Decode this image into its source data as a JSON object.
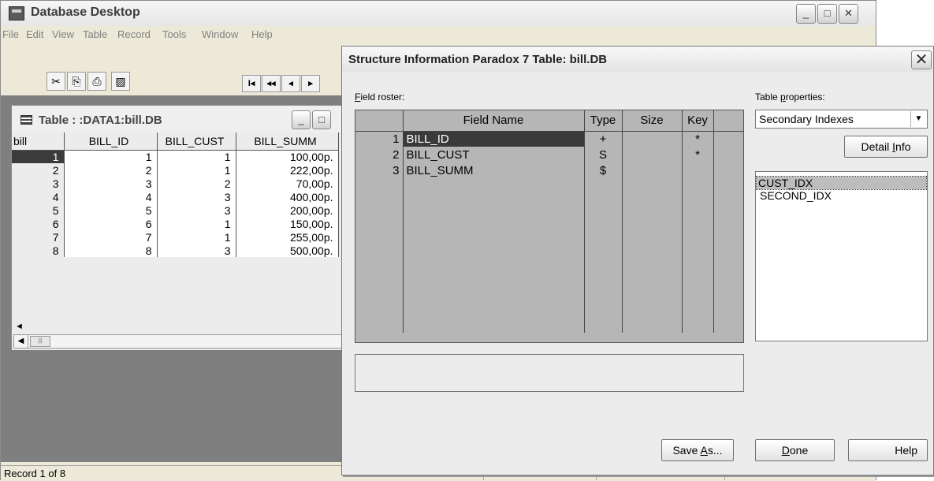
{
  "app": {
    "title": "Database Desktop",
    "menu": [
      "File",
      "Edit",
      "View",
      "Table",
      "Record",
      "Tools",
      "Window",
      "Help"
    ],
    "status": "Record 1 of 8"
  },
  "toolbar": {
    "cut_icon": "✂",
    "copy_icon": "⎘",
    "paste_icon": "⎙",
    "props_icon": "▨",
    "nav_first": "I◂",
    "nav_prev_page": "◂◂",
    "nav_prev": "◂",
    "nav_next": "▸"
  },
  "table_window": {
    "title": "Table : :DATA1:bill.DB",
    "columns": [
      "bill",
      "BILL_ID",
      "BILL_CUST",
      "BILL_SUMM"
    ],
    "rows": [
      [
        "1",
        "1",
        "1",
        "100,00р."
      ],
      [
        "2",
        "2",
        "1",
        "222,00р."
      ],
      [
        "3",
        "3",
        "2",
        "70,00р."
      ],
      [
        "4",
        "4",
        "3",
        "400,00р."
      ],
      [
        "5",
        "5",
        "3",
        "200,00р."
      ],
      [
        "6",
        "6",
        "1",
        "150,00р."
      ],
      [
        "7",
        "7",
        "1",
        "255,00р."
      ],
      [
        "8",
        "8",
        "3",
        "500,00р."
      ]
    ],
    "scroll_marker": "◄"
  },
  "dialog": {
    "title": "Structure Information Paradox 7 Table: bill.DB",
    "close_glyph": "✕",
    "field_roster": {
      "label_accel": "F",
      "label_rest": "ield roster:",
      "columns": [
        "Field Name",
        "Type",
        "Size",
        "Key"
      ],
      "rows": [
        {
          "num": "1",
          "name": "BILL_ID",
          "type": "+",
          "size": "",
          "key": "*"
        },
        {
          "num": "2",
          "name": "BILL_CUST",
          "type": "S",
          "size": "",
          "key": "*"
        },
        {
          "num": "3",
          "name": "BILL_SUMM",
          "type": "$",
          "size": "",
          "key": ""
        }
      ]
    },
    "table_properties": {
      "label_pre": "Table ",
      "label_accel": "p",
      "label_post": "roperties:",
      "selected": "Secondary Indexes",
      "indexes": [
        "CUST_IDX",
        "SECOND_IDX"
      ]
    },
    "buttons": {
      "detail_pre": "Detail ",
      "detail_accel": "I",
      "detail_post": "nfo",
      "save_pre": "Save ",
      "save_accel": "A",
      "save_post": "s...",
      "done_accel": "D",
      "done_post": "one",
      "help": "Help"
    }
  },
  "window_controls": {
    "minimize": "_",
    "maximize": "□",
    "close": "✕"
  }
}
